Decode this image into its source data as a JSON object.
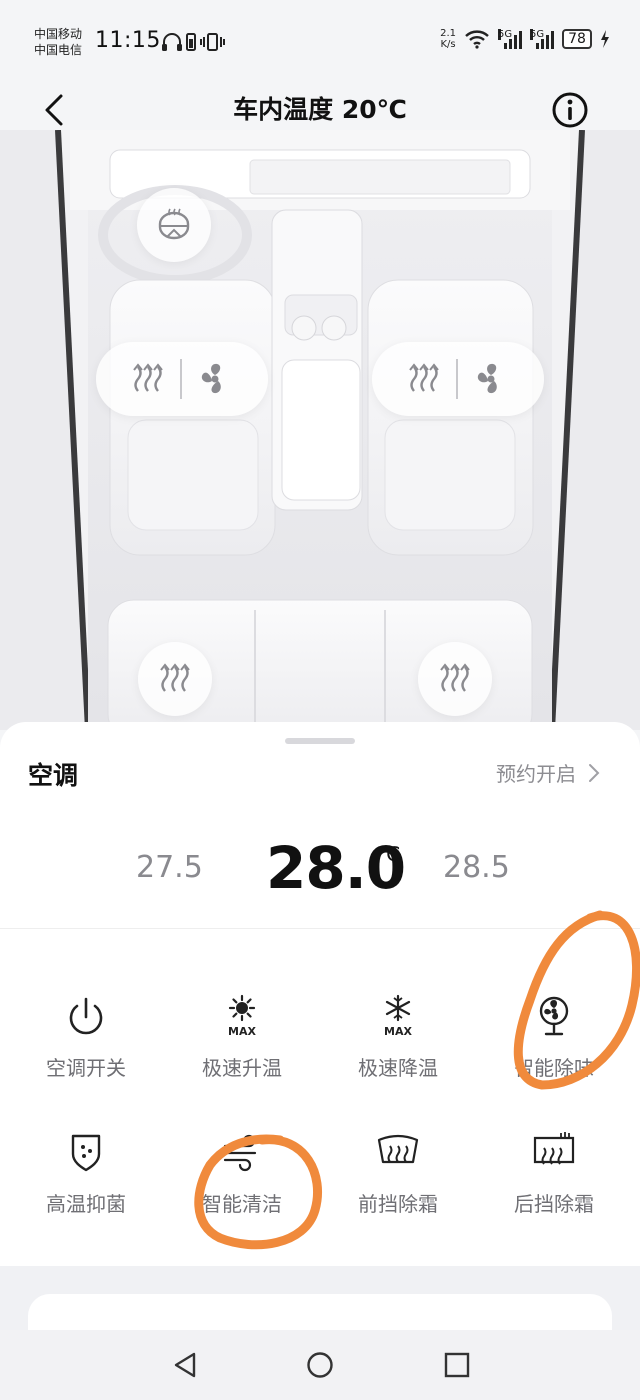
{
  "status_bar": {
    "carrier_1": "中国移动",
    "carrier_2": "中国电信",
    "time": "11:15",
    "net_speed_value": "2.1",
    "net_speed_unit": "K/s",
    "sim1_tag": "5G",
    "sim2_tag": "5G",
    "battery": "78"
  },
  "header": {
    "title": "车内温度 20℃"
  },
  "sheet": {
    "title": "空调",
    "schedule_label": "预约开启",
    "temp_prev": "27.5",
    "temp_current": "28.0",
    "temp_unit": "℃",
    "temp_next": "28.5",
    "functions": [
      {
        "label": "空调开关",
        "icon": "power-icon"
      },
      {
        "label": "极速升温",
        "icon": "sun-max-icon"
      },
      {
        "label": "极速降温",
        "icon": "snowflake-max-icon"
      },
      {
        "label": "智能除味",
        "icon": "fan-icon"
      },
      {
        "label": "高温抑菌",
        "icon": "shield-dots-icon"
      },
      {
        "label": "智能清洁",
        "icon": "wind-icon"
      },
      {
        "label": "前挡除霜",
        "icon": "front-defrost-icon"
      },
      {
        "label": "后挡除霜",
        "icon": "rear-defrost-icon"
      }
    ],
    "max_badge": "MAX"
  },
  "colors": {
    "annotation": "#F08A3C",
    "icon_stroke": "#222222",
    "label": "#6f6f74",
    "muted_temp": "#8a8a8f"
  }
}
